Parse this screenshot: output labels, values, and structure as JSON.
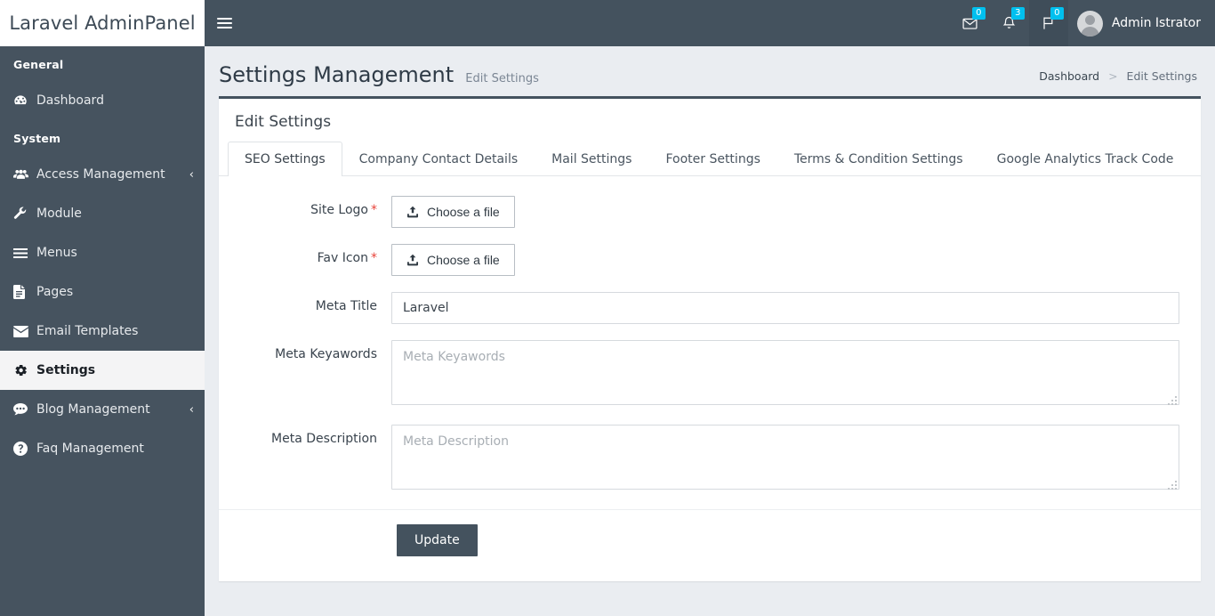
{
  "brand": {
    "title": "Laravel AdminPanel"
  },
  "sidebar": {
    "sections": [
      {
        "header": "General",
        "items": [
          {
            "label": "Dashboard",
            "icon": "dashboard-icon",
            "chevron": "",
            "active": false
          }
        ]
      },
      {
        "header": "System",
        "items": [
          {
            "label": "Access Management",
            "icon": "users-icon",
            "chevron": "‹",
            "active": false
          },
          {
            "label": "Module",
            "icon": "wrench-icon",
            "chevron": "",
            "active": false
          },
          {
            "label": "Menus",
            "icon": "list-icon",
            "chevron": "",
            "active": false
          },
          {
            "label": "Pages",
            "icon": "file-icon",
            "chevron": "",
            "active": false
          },
          {
            "label": "Email Templates",
            "icon": "envelope-icon",
            "chevron": "",
            "active": false
          },
          {
            "label": "Settings",
            "icon": "gear-icon",
            "chevron": "",
            "active": true
          },
          {
            "label": "Blog Management",
            "icon": "comment-icon",
            "chevron": "‹",
            "active": false
          },
          {
            "label": "Faq Management",
            "icon": "question-circle-icon",
            "chevron": "",
            "active": false
          }
        ]
      }
    ]
  },
  "navbar": {
    "menu_toggle": "hamburger-icon",
    "icons": [
      {
        "name": "messages-icon",
        "glyph": "envelope",
        "badge": "0",
        "highlight": false
      },
      {
        "name": "notifications-icon",
        "glyph": "bell",
        "badge": "3",
        "highlight": false
      },
      {
        "name": "tasks-icon",
        "glyph": "flag",
        "badge": "0",
        "highlight": true
      }
    ],
    "user_name": "Admin Istrator"
  },
  "page": {
    "title": "Settings Management",
    "subtitle": "Edit Settings",
    "breadcrumb": {
      "root": "Dashboard",
      "separator": ">",
      "current": "Edit Settings"
    }
  },
  "card": {
    "heading": "Edit Settings",
    "tabs": [
      {
        "label": "SEO Settings",
        "active": true
      },
      {
        "label": "Company Contact Details",
        "active": false
      },
      {
        "label": "Mail Settings",
        "active": false
      },
      {
        "label": "Footer Settings",
        "active": false
      },
      {
        "label": "Terms & Condition Settings",
        "active": false
      },
      {
        "label": "Google Analytics Track Code",
        "active": false
      }
    ]
  },
  "form": {
    "site_logo": {
      "label": "Site Logo",
      "required": "*",
      "button": "Choose a file"
    },
    "fav_icon": {
      "label": "Fav Icon",
      "required": "*",
      "button": "Choose a file"
    },
    "meta_title": {
      "label": "Meta Title",
      "value": "Laravel",
      "placeholder": "Meta Title"
    },
    "meta_keywords": {
      "label": "Meta Keyawords",
      "value": "",
      "placeholder": "Meta Keyawords"
    },
    "meta_description": {
      "label": "Meta Description",
      "value": "",
      "placeholder": "Meta Description"
    },
    "submit": "Update"
  },
  "colors": {
    "sidebar": "#46535f",
    "navbar": "#44525e",
    "page_bg": "#eaedf1",
    "badge": "#00c0ef",
    "required": "#e8433a",
    "primary_button": "#44525e"
  }
}
